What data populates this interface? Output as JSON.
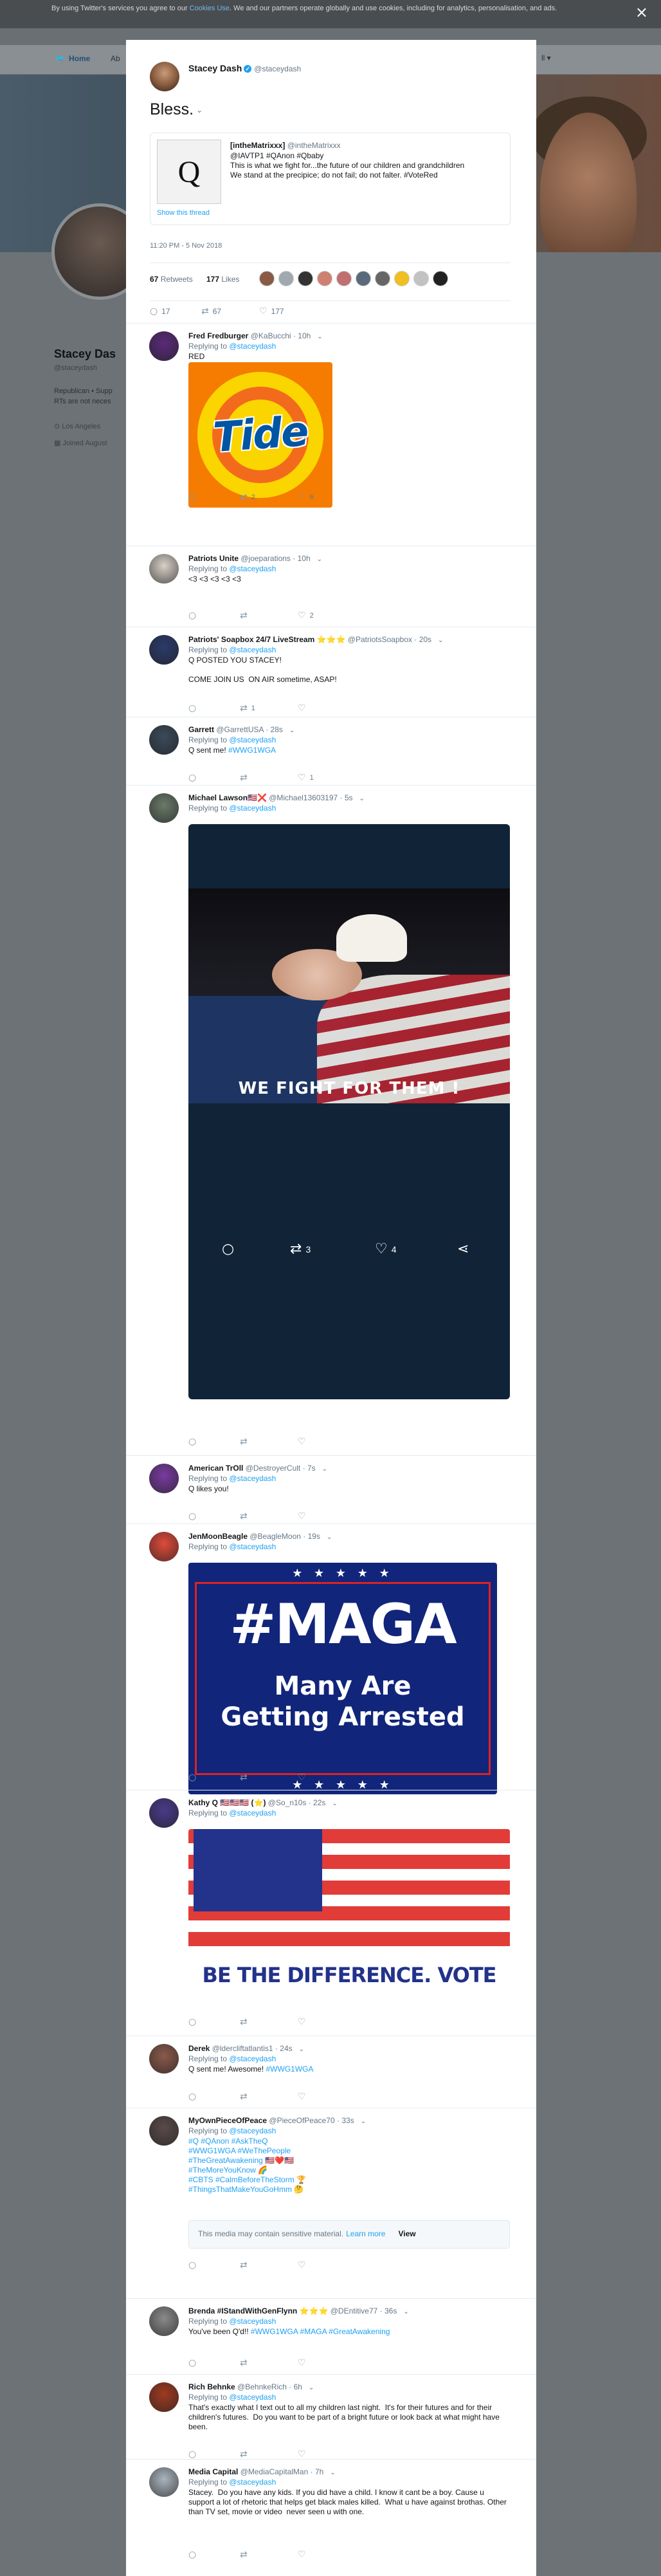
{
  "cookie": {
    "text_before": "By using Twitter's services you agree to our ",
    "link": "Cookies Use",
    "text_after": ". We and our partners operate globally and use cookies, including for analytics, personalisation, and ads.",
    "close": "×"
  },
  "topnav": {
    "home": "Home",
    "about": "Ab",
    "right": "ll ▾"
  },
  "profile": {
    "name": "Stacey Das",
    "handle": "@staceydash",
    "bio": "Republican • Supp RTs are not neces",
    "location": "⊙ Los Angeles",
    "joined": "▦ Joined August"
  },
  "main_tweet": {
    "name": "Stacey Dash",
    "verified": "✓",
    "handle": "@staceydash",
    "text": "Bless.",
    "quote": {
      "name": "[intheMatrixxx]",
      "handle": "@intheMatrixxx",
      "image_letter": "Q",
      "text": "@IAVTP1 #QAnon #Qbaby\nThis is what we fight for...the future of our children and grandchildren\nWe stand at the precipice; do not fail; do not falter. #VoteRed",
      "show_thread": "Show this thread"
    },
    "time": "11:20 PM - 5 Nov 2018",
    "retweets_num": "67",
    "retweets_label": "Retweets",
    "likes_num": "177",
    "likes_label": "Likes",
    "reply_count": "17",
    "retweet_count": "67",
    "like_count": "177",
    "face_colors": [
      "#8a5a44",
      "#a0a8b0",
      "#333333",
      "#d08070",
      "#c07070",
      "#5a6a7a",
      "#666666",
      "#f0c020",
      "#c2c2c2",
      "#222222"
    ]
  },
  "replies": [
    {
      "name": "Fred Fredburger",
      "handle": "@KaBucchi",
      "time": "· 10h",
      "reply_to": "@staceydash",
      "text": "RED",
      "reply": "",
      "retweet": "2",
      "like": "6",
      "avatar": "#5a2a7a"
    },
    {
      "name": "Patriots Unite",
      "handle": "@joeparations",
      "time": "· 10h",
      "reply_to": "@staceydash",
      "text": "<3 <3 <3 <3 <3",
      "reply": "",
      "retweet": "",
      "like": "2",
      "avatar": "#d8d0c8"
    },
    {
      "name": "Patriots' Soapbox 24/7 LiveStream ⭐⭐⭐",
      "handle": "@PatriotsSoapbox",
      "time": "· 20s",
      "reply_to": "@staceydash",
      "text": "Q POSTED YOU STACEY!\n\nCOME JOIN US  ON AIR sometime, ASAP!",
      "reply": "",
      "retweet": "1",
      "like": "",
      "avatar": "#2a3a6a"
    },
    {
      "name": "Garrett",
      "handle": "@GarrettUSA",
      "time": "· 28s",
      "reply_to": "@staceydash",
      "text_plain": "Q sent me! ",
      "text_tag": "#WWG1WGA",
      "reply": "",
      "retweet": "",
      "like": "1",
      "avatar": "#3a4a5a"
    },
    {
      "name": "Michael Lawson🇺🇸❌",
      "handle": "@Michael13603197",
      "time": "· 5s",
      "reply_to": "@staceydash",
      "reply": "",
      "retweet": "",
      "like": "",
      "avatar": "#6a7a6a",
      "video": {
        "caption": "WE FIGHT FOR THEM !",
        "retweets": "3",
        "likes": "4"
      }
    },
    {
      "name": "American TrOll",
      "handle": "@DestroyerCult",
      "time": "· 7s",
      "reply_to": "@staceydash",
      "text": "Q likes you!",
      "reply": "",
      "retweet": "",
      "like": "",
      "avatar": "#7a3aa0"
    },
    {
      "name": "JenMoonBeagle",
      "handle": "@BeagleMoon",
      "time": "· 19s",
      "reply_to": "@staceydash",
      "reply": "",
      "retweet": "",
      "like": "",
      "avatar": "#e04a3a",
      "image": {
        "stars": "★ ★ ★ ★ ★",
        "line1": "#MAGA",
        "line2": "Many Are\nGetting Arrested"
      }
    },
    {
      "name": "Kathy Q 🇺🇸🇺🇸🇺🇸 (⭐)",
      "handle": "@So_n10s",
      "time": "· 22s",
      "reply_to": "@staceydash",
      "reply": "",
      "retweet": "",
      "like": "",
      "avatar": "#4a3a8a",
      "image": {
        "text": "BE THE DIFFERENCE. VOTE"
      }
    },
    {
      "name": "Derek",
      "handle": "@ldercliftatlantis1",
      "time": "· 24s",
      "reply_to": "@staceydash",
      "text_plain": "Q sent me! Awesome! ",
      "text_tag": "#WWG1WGA",
      "reply": "",
      "retweet": "",
      "like": "",
      "avatar": "#8a5a4a"
    },
    {
      "name": "MyOwnPieceOfPeace",
      "handle": "@PieceOfPeace70",
      "time": "· 33s",
      "reply_to": "@staceydash",
      "text_tags": "#Q #QAnon #AskTheQ\n#WWG1WGA #WeThePeople\n#TheGreatAwakening 🇺🇸❤️🇺🇸\n#TheMoreYouKnow 🌈\n#CBTS #CalmBeforeTheStorm 🏆\n#ThingsThatMakeYouGoHmm 🤔",
      "sensitive": "This media may contain sensitive material.",
      "learn_more": "Learn more",
      "view": "View",
      "reply": "",
      "retweet": "",
      "like": "",
      "avatar": "#5a4a4a"
    },
    {
      "name": "Brenda #IStandWithGenFlynn ⭐⭐⭐",
      "handle": "@DEntitive77",
      "time": "· 36s",
      "reply_to": "@staceydash",
      "text_plain": "You've been Q'd!! ",
      "text_tag": "#WWG1WGA #MAGA #GreatAwakening",
      "reply": "",
      "retweet": "",
      "like": "",
      "avatar": "#8a8a8a"
    },
    {
      "name": "Rich Behnke",
      "handle": "@BehnkeRich",
      "time": "· 6h",
      "reply_to": "@staceydash",
      "text": "That's exactly what I text out to all my children last night.  It's for their futures and for their children's futures.  Do you want to be part of a bright future or look back at what might have been.",
      "reply": "",
      "retweet": "",
      "like": "",
      "avatar": "#a03a20"
    },
    {
      "name": "Media Capital",
      "handle": "@MediaCapitalMan",
      "time": "· 7h",
      "reply_to": "@staceydash",
      "text": "Stacey.  Do you have any kids. If you did have a child. I know it cant be a boy. Cause u support a lot of rhetoric that helps get black males killed.  What u have against brothas. Other than TV set, movie or video  never seen u with one.",
      "reply": "",
      "retweet": "",
      "like": "",
      "avatar": "#aab4be"
    }
  ]
}
